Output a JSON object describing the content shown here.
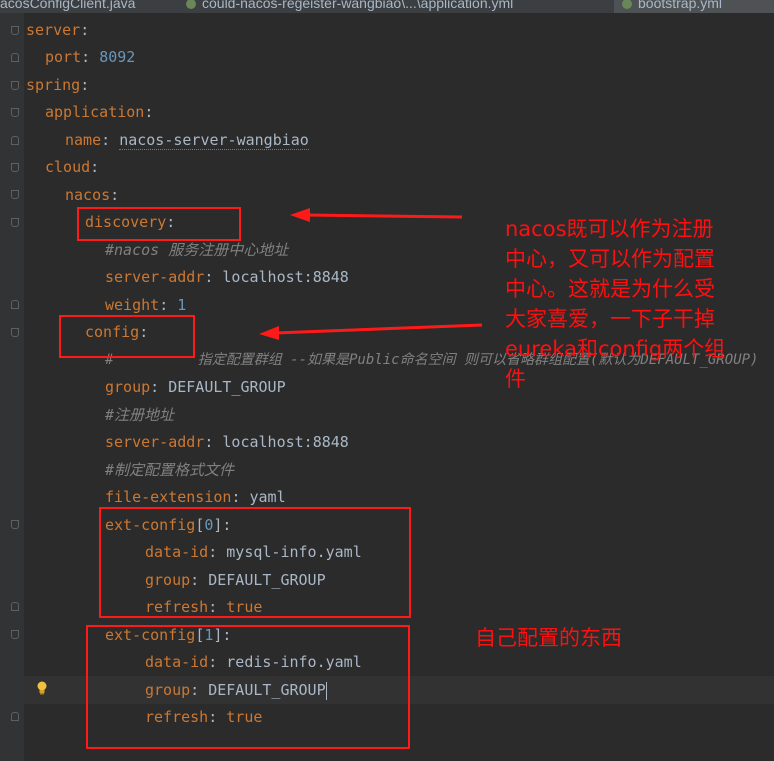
{
  "tabs": [
    {
      "label": "acosConfigClient.java"
    },
    {
      "label": "could-nacos-regeister-wangbiao\\...\\application.yml"
    },
    {
      "label": "bootstrap.yml"
    }
  ],
  "code": {
    "l1": {
      "key": "server",
      "colon": ":"
    },
    "l2": {
      "key": "port",
      "colon": ": ",
      "value": "8092"
    },
    "l3": {
      "key": "spring",
      "colon": ":"
    },
    "l4": {
      "key": "application",
      "colon": ":"
    },
    "l5": {
      "key": "name",
      "colon": ": ",
      "value": "nacos-server-wangbiao"
    },
    "l6": {
      "key": "cloud",
      "colon": ":"
    },
    "l7": {
      "key": "nacos",
      "colon": ":"
    },
    "l8": {
      "key": "discovery",
      "colon": ":"
    },
    "l9": {
      "comment": "#nacos 服务注册中心地址"
    },
    "l10": {
      "key": "server-addr",
      "colon": ": ",
      "value": "localhost:8848"
    },
    "l11": {
      "key": "weight",
      "colon": ": ",
      "value": "1"
    },
    "l12": {
      "key": "config",
      "colon": ":"
    },
    "l13": {
      "comment": "#          指定配置群组 --如果是Public命名空间 则可以省略群组配置(默认为DEFAULT_GROUP)"
    },
    "l14": {
      "key": "group",
      "colon": ": ",
      "value": "DEFAULT_GROUP"
    },
    "l15": {
      "comment": "#注册地址"
    },
    "l16": {
      "key": "server-addr",
      "colon": ": ",
      "value": "localhost:8848"
    },
    "l17": {
      "comment": "#制定配置格式文件"
    },
    "l18": {
      "key": "file-extension",
      "colon": ": ",
      "value": "yaml"
    },
    "l19": {
      "key": "ext-config",
      "bracket_open": "[",
      "index": "0",
      "bracket_close": "]",
      "colon": ":"
    },
    "l20": {
      "key": "data-id",
      "colon": ": ",
      "value": "mysql-info.yaml"
    },
    "l21": {
      "key": "group",
      "colon": ": ",
      "value": "DEFAULT_GROUP"
    },
    "l22": {
      "key": "refresh",
      "colon": ": ",
      "value": "true"
    },
    "l23": {
      "key": "ext-config",
      "bracket_open": "[",
      "index": "1",
      "bracket_close": "]",
      "colon": ":"
    },
    "l24": {
      "key": "data-id",
      "colon": ": ",
      "value": "redis-info.yaml"
    },
    "l25": {
      "key": "group",
      "colon": ": ",
      "value": "DEFAULT_GROUP"
    },
    "l26": {
      "key": "refresh",
      "colon": ": ",
      "value": "true"
    }
  },
  "annotations": {
    "note1_lines": [
      "nacos既可以作为注册",
      "中心，又可以作为配置",
      "中心。这就是为什么受",
      "大家喜爱，一下子干掉",
      "eureka和config两个组",
      "件"
    ],
    "note2": "自己配置的东西"
  },
  "colors": {
    "annotation": "#ff1a1a",
    "key": "#cc7832",
    "number": "#6897bb",
    "comment": "#808080",
    "background": "#2b2b2b"
  }
}
